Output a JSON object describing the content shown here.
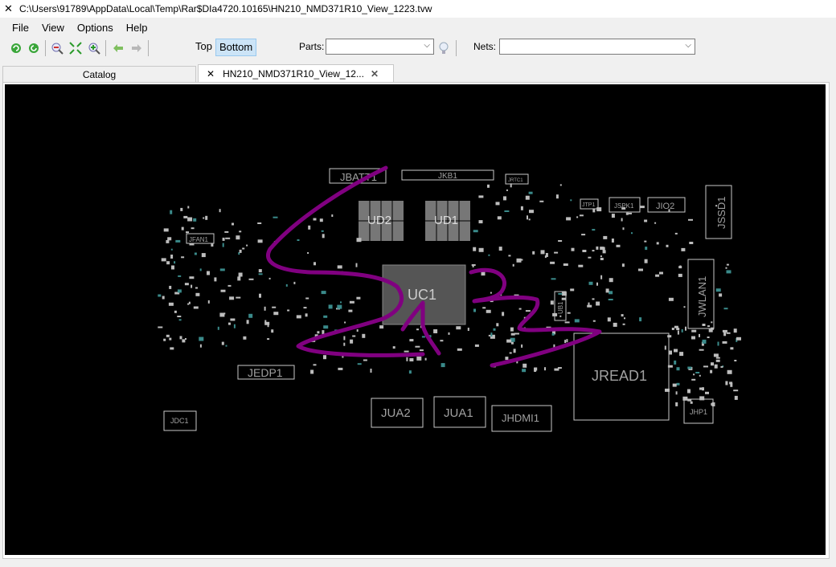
{
  "window": {
    "title": "C:\\Users\\91789\\AppData\\Local\\Temp\\Rar$DIa4720.10165\\HN210_NMD371R10_View_1223.tvw",
    "icon": "boardview-icon"
  },
  "menu": [
    "File",
    "View",
    "Options",
    "Help"
  ],
  "toolbar": {
    "buttons": [
      "refresh-icon",
      "rotate-icon",
      "zoom-out-icon",
      "fit-icon",
      "zoom-in-icon",
      "back-arrow-icon",
      "forward-arrow-icon"
    ],
    "top_label": "Top",
    "bottom_label": "Bottom",
    "active_side": "Bottom",
    "parts_label": "Parts:",
    "parts_value": "",
    "nets_label": "Nets:",
    "nets_value": "",
    "bulb_icon": "lightbulb-icon"
  },
  "tabs": [
    {
      "label": "Catalog",
      "active": false
    },
    {
      "label": "HN210_NMD371R10_View_12...",
      "active": true,
      "icon": "boardview-icon",
      "close_icon": "close-icon"
    }
  ],
  "board": {
    "background": "#000000",
    "outline_color": "#c0c0c0",
    "annotation_color": "#800080",
    "components": [
      "JBATT1",
      "JKB1",
      "UD2",
      "UD1",
      "UC1",
      "JFAN1",
      "JEDP1",
      "JUA2",
      "JUA1",
      "JHDMI1",
      "JREAD1",
      "JSSD1",
      "JWLAN1",
      "JIO2",
      "JSPK1",
      "JTP1",
      "JHP1",
      "UB1",
      "JRTC1",
      "JDC1"
    ]
  }
}
